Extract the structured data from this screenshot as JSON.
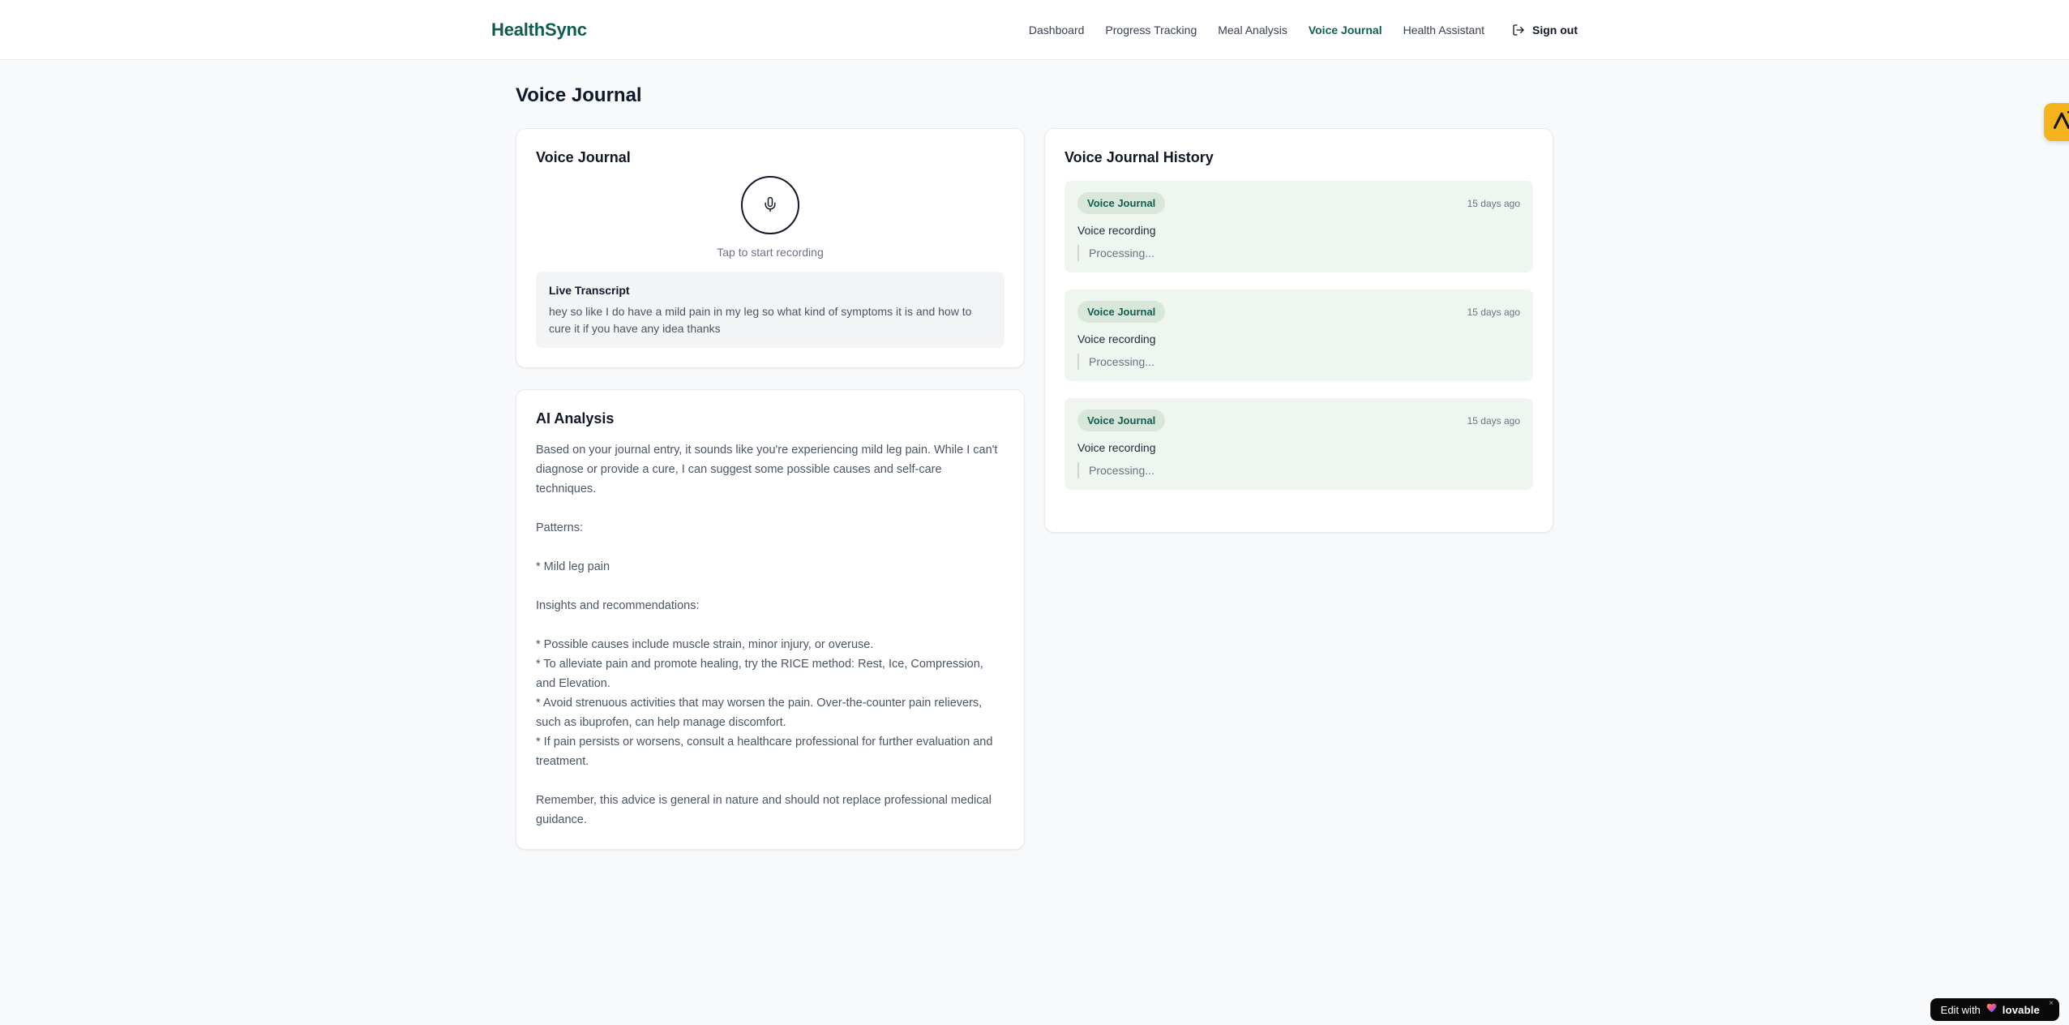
{
  "brand": {
    "name": "HealthSync"
  },
  "nav": {
    "items": [
      {
        "label": "Dashboard",
        "active": false
      },
      {
        "label": "Progress Tracking",
        "active": false
      },
      {
        "label": "Meal Analysis",
        "active": false
      },
      {
        "label": "Voice Journal",
        "active": true
      },
      {
        "label": "Health Assistant",
        "active": false
      }
    ],
    "sign_out_label": "Sign out"
  },
  "page": {
    "title": "Voice Journal"
  },
  "recorder_card": {
    "title": "Voice Journal",
    "tap_hint": "Tap to start recording",
    "live_transcript": {
      "title": "Live Transcript",
      "text": "hey so like I do have a mild pain in my leg so what kind of symptoms it is and how to cure it if you have any idea thanks"
    }
  },
  "analysis_card": {
    "title": "AI Analysis",
    "body": "Based on your journal entry, it sounds like you're experiencing mild leg pain. While I can't diagnose or provide a cure, I can suggest some possible causes and self-care techniques.\n\nPatterns:\n\n* Mild leg pain\n\nInsights and recommendations:\n\n* Possible causes include muscle strain, minor injury, or overuse.\n* To alleviate pain and promote healing, try the RICE method: Rest, Ice, Compression, and Elevation.\n* Avoid strenuous activities that may worsen the pain. Over-the-counter pain relievers, such as ibuprofen, can help manage discomfort.\n* If pain persists or worsens, consult a healthcare professional for further evaluation and treatment.\n\nRemember, this advice is general in nature and should not replace professional medical guidance."
  },
  "history_card": {
    "title": "Voice Journal History",
    "entries": [
      {
        "badge": "Voice Journal",
        "time": "15 days ago",
        "label": "Voice recording",
        "status": "Processing..."
      },
      {
        "badge": "Voice Journal",
        "time": "15 days ago",
        "label": "Voice recording",
        "status": "Processing..."
      },
      {
        "badge": "Voice Journal",
        "time": "15 days ago",
        "label": "Voice recording",
        "status": "Processing..."
      }
    ]
  },
  "overlays": {
    "edit_badge": {
      "prefix": "Edit with",
      "brand": "lovable",
      "close": "×"
    }
  },
  "colors": {
    "primary_teal": "#0d5c4f",
    "page_bg": "#f8f9fb",
    "entry_bg": "#eef6ef",
    "badge_pill_bg": "#d9e7db",
    "badge_pill_text": "#115e4f",
    "launcher_amber": "#f5b41d",
    "edit_badge_bg": "#0a0a0a"
  }
}
